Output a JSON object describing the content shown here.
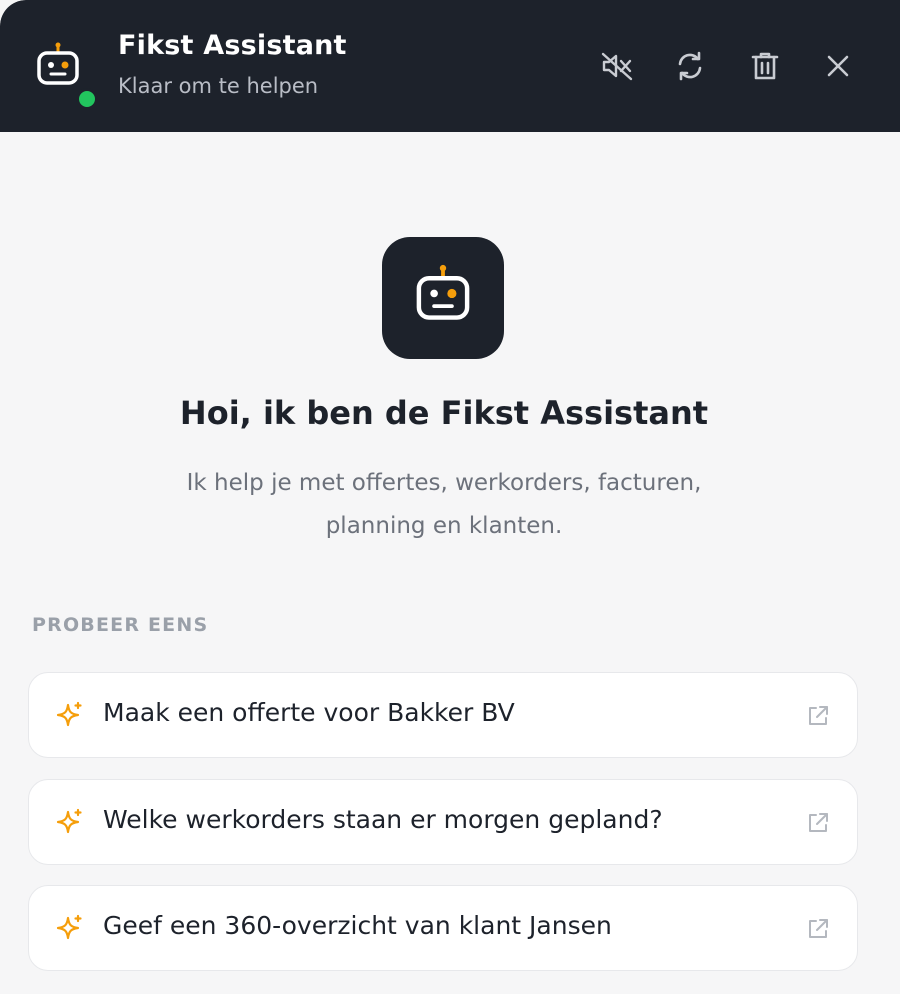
{
  "header": {
    "title": "Fikst Assistant",
    "subtitle": "Klaar om te helpen",
    "status_color": "#22c55e",
    "background": "#1d222b",
    "actions": [
      {
        "name": "mute",
        "icon": "speaker-muted-icon"
      },
      {
        "name": "refresh",
        "icon": "refresh-icon"
      },
      {
        "name": "delete",
        "icon": "trash-icon"
      },
      {
        "name": "close",
        "icon": "close-icon"
      }
    ]
  },
  "hero": {
    "icon": "robot-icon",
    "accent_color": "#f59e0b",
    "title": "Hoi, ik ben de Fikst Assistant",
    "description_line1": "Ik help je met offertes, werkorders, facturen,",
    "description_line2": "planning en klanten."
  },
  "suggestions": {
    "label": "PROBEER EENS",
    "items": [
      {
        "text": "Maak een offerte voor Bakker BV",
        "icon": "sparkle-icon",
        "action_icon": "external-link-icon"
      },
      {
        "text": "Welke werkorders staan er morgen gepland?",
        "icon": "sparkle-icon",
        "action_icon": "external-link-icon"
      },
      {
        "text": "Geef een 360-overzicht van klant Jansen",
        "icon": "sparkle-icon",
        "action_icon": "external-link-icon"
      }
    ]
  }
}
